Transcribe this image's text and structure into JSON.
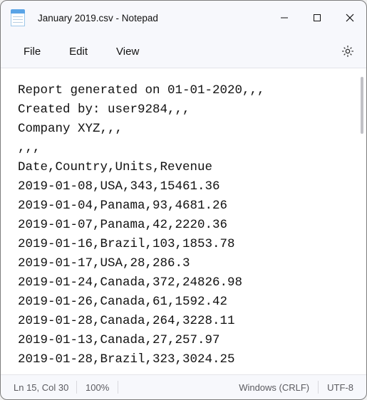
{
  "window": {
    "title": "January 2019.csv - Notepad"
  },
  "menu": {
    "file": "File",
    "edit": "Edit",
    "view": "View"
  },
  "document": {
    "lines": [
      "Report generated on 01-01-2020,,,",
      "Created by: user9284,,,",
      "Company XYZ,,,",
      ",,,",
      "Date,Country,Units,Revenue",
      "2019-01-08,USA,343,15461.36",
      "2019-01-04,Panama,93,4681.26",
      "2019-01-07,Panama,42,2220.36",
      "2019-01-16,Brazil,103,1853.78",
      "2019-01-17,USA,28,286.3",
      "2019-01-24,Canada,372,24826.98",
      "2019-01-26,Canada,61,1592.42",
      "2019-01-28,Canada,264,3228.11",
      "2019-01-13,Canada,27,257.97",
      "2019-01-28,Brazil,323,3024.25"
    ]
  },
  "status": {
    "cursor": "Ln 15, Col 30",
    "zoom": "100%",
    "line_ending": "Windows (CRLF)",
    "encoding": "UTF-8"
  }
}
